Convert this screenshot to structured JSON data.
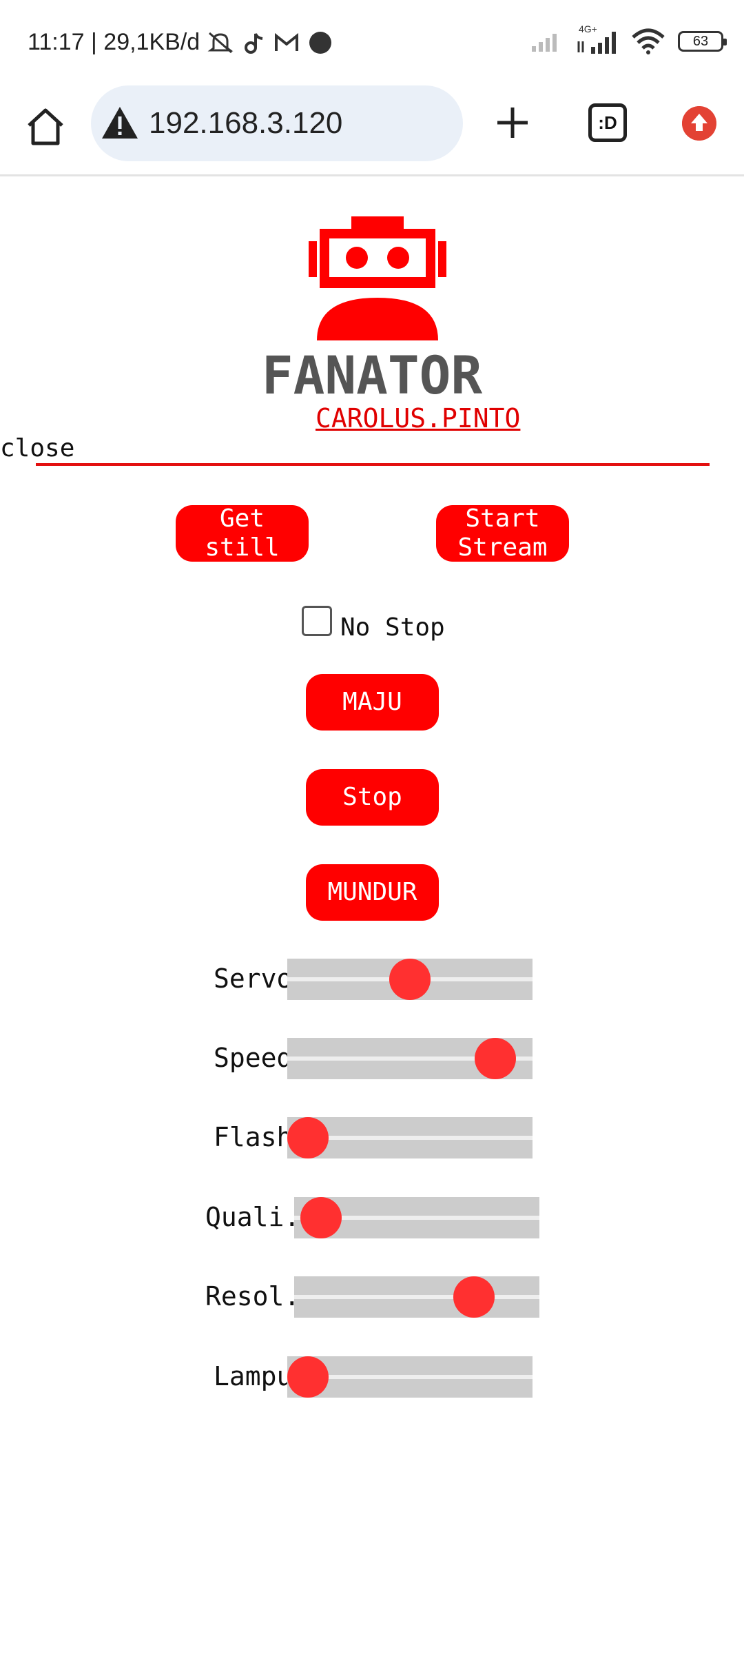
{
  "status_bar": {
    "time_info": "11:17 | 29,1KB/d",
    "network": "4G+",
    "battery": "63"
  },
  "browser": {
    "url": "192.168.3.120",
    "tabs_icon": ":D"
  },
  "page": {
    "title": "FANATOR",
    "author": "CAROLUS.PINTO",
    "close": "close",
    "buttons": {
      "get_still": "Get still",
      "start_stream": "Start Stream",
      "maju": "MAJU",
      "stop": "Stop",
      "mundur": "MUNDUR"
    },
    "no_stop_label": "No Stop",
    "no_stop_checked": false,
    "sliders": [
      {
        "label": "Servo",
        "fraction": 0.5
      },
      {
        "label": "Speed",
        "fraction": 0.92
      },
      {
        "label": "Flash",
        "fraction": 0.0
      },
      {
        "label": "Quali.",
        "fraction": 0.03
      },
      {
        "label": "Resol.",
        "fraction": 0.78
      },
      {
        "label": "Lampu",
        "fraction": 0.0
      }
    ]
  },
  "colors": {
    "accent": "#ff0000",
    "thumb": "#ff3030",
    "track": "#cccccc",
    "title": "#555555"
  }
}
